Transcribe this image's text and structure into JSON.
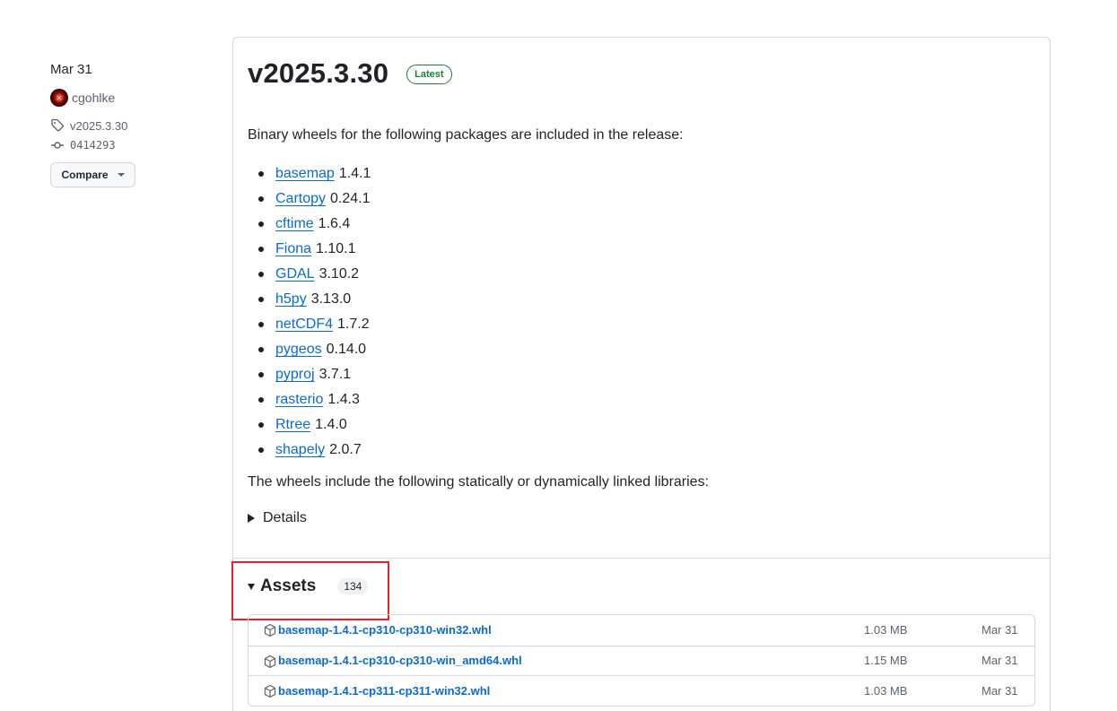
{
  "meta": {
    "date": "Mar 31",
    "user": "cgohlke",
    "tag": "v2025.3.30",
    "commit": "0414293",
    "compare_label": "Compare"
  },
  "release": {
    "title": "v2025.3.30",
    "badge": "Latest",
    "intro": "Binary wheels for the following packages are included in the release:",
    "packages": [
      {
        "name": "basemap",
        "version": "1.4.1"
      },
      {
        "name": "Cartopy",
        "version": "0.24.1"
      },
      {
        "name": "cftime",
        "version": "1.6.4"
      },
      {
        "name": "Fiona",
        "version": "1.10.1"
      },
      {
        "name": "GDAL",
        "version": "3.10.2"
      },
      {
        "name": "h5py",
        "version": "3.13.0"
      },
      {
        "name": "netCDF4",
        "version": "1.7.2"
      },
      {
        "name": "pygeos",
        "version": "0.14.0"
      },
      {
        "name": "pyproj",
        "version": "3.7.1"
      },
      {
        "name": "rasterio",
        "version": "1.4.3"
      },
      {
        "name": "Rtree",
        "version": "1.4.0"
      },
      {
        "name": "shapely",
        "version": "2.0.7"
      }
    ],
    "libs_text": "The wheels include the following statically or dynamically linked libraries:",
    "details_label": "Details"
  },
  "assets": {
    "title": "Assets",
    "count": "134",
    "items": [
      {
        "name": "basemap-1.4.1-cp310-cp310-win32.whl",
        "size": "1.03 MB",
        "date": "Mar 31"
      },
      {
        "name": "basemap-1.4.1-cp310-cp310-win_amd64.whl",
        "size": "1.15 MB",
        "date": "Mar 31"
      },
      {
        "name": "basemap-1.4.1-cp311-cp311-win32.whl",
        "size": "1.03 MB",
        "date": "Mar 31"
      }
    ]
  },
  "colors": {
    "link": "#0969da",
    "latest_badge": "#1a7f37",
    "highlight": "#e5242b"
  },
  "icons": [
    "tag-icon",
    "commit-icon",
    "package-icon",
    "caret-down-icon",
    "triangle-right-icon",
    "triangle-down-icon"
  ]
}
